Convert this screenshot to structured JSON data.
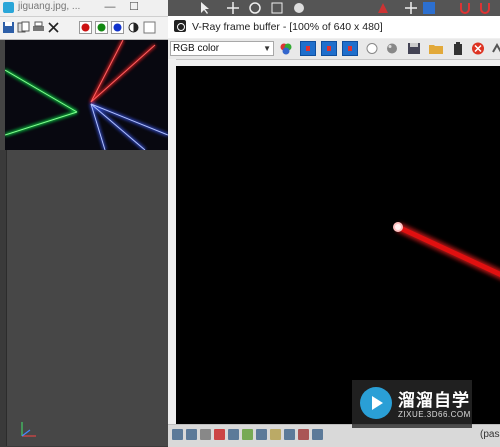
{
  "viewer": {
    "title": "jiguang.jpg, ...",
    "controls": {
      "minimize": "—",
      "maximize": "☐"
    },
    "swatches": {
      "red": "#cc1111",
      "green": "#118811",
      "blue": "#1133cc"
    }
  },
  "vfb": {
    "title": "V-Ray frame buffer - [100% of 640 x 480]",
    "channel": "RGB color",
    "status_text": "(pass"
  },
  "watermark": {
    "brand": "溜溜自学",
    "url": "ZIXUE.3D66.COM"
  },
  "colors": {
    "laser_red": "#e01010",
    "laser_green": "#10d040",
    "laser_blue": "#4060ff",
    "accent_blue": "#1f6fcc"
  }
}
